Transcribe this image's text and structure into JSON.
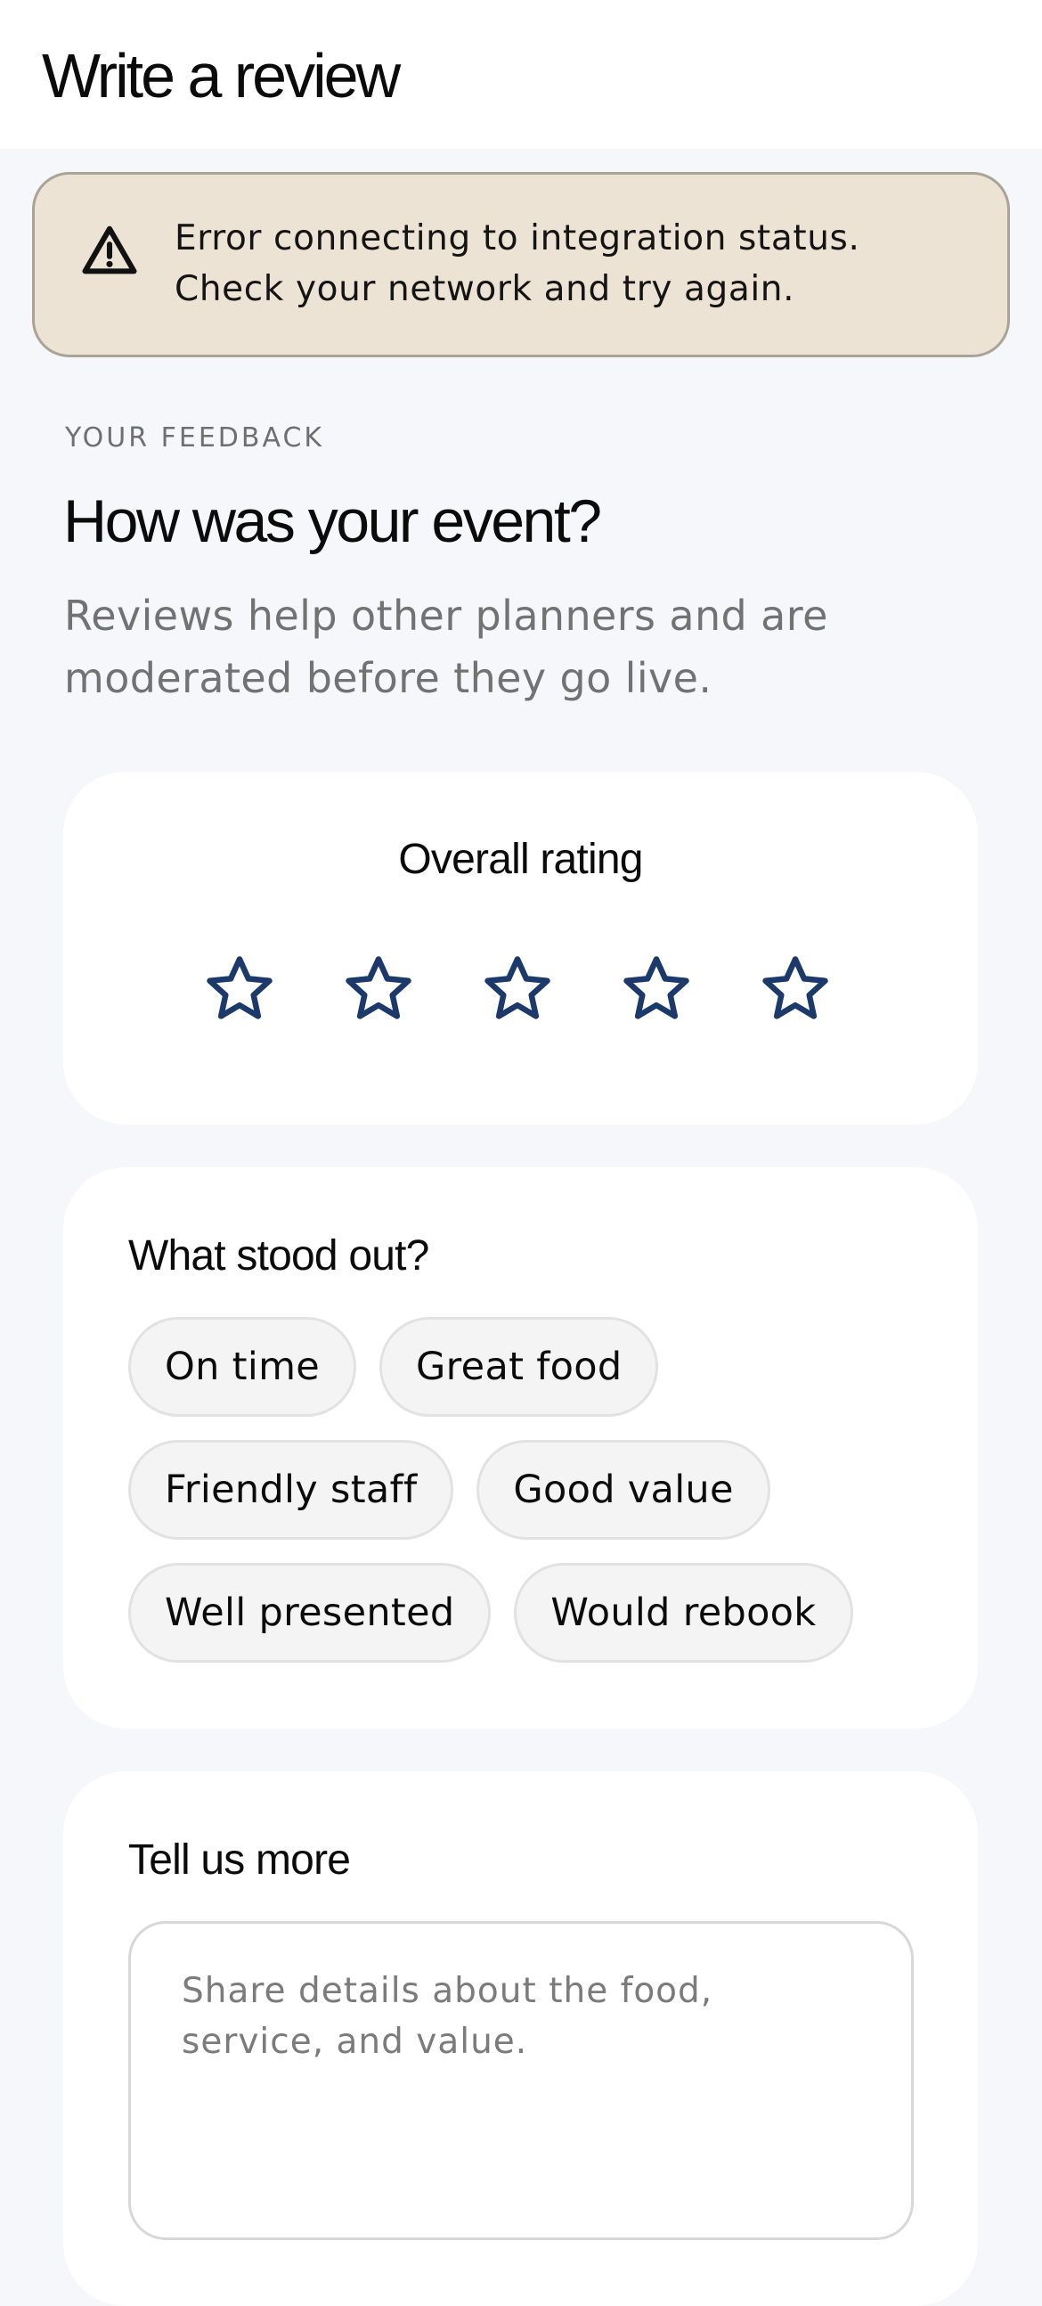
{
  "header": {
    "title": "Write a review"
  },
  "alert": {
    "icon": "warning-triangle-icon",
    "message": "Error connecting to integration status. Check your network and try again.",
    "background": "#ede3d5",
    "border": "#aaa396"
  },
  "intro": {
    "eyebrow": "YOUR FEEDBACK",
    "title": "How was your event?",
    "subtitle": "Reviews help other planners and are moderated before they go live."
  },
  "rating": {
    "label": "Overall rating",
    "value": 0,
    "max": 5,
    "star_icon": "star-outline-icon",
    "star_color": "#1b3a6b"
  },
  "highlights": {
    "label": "What stood out?",
    "rows": [
      [
        "On time",
        "Great food"
      ],
      [
        "Friendly staff",
        "Good value"
      ],
      [
        "Well presented",
        "Would rebook"
      ]
    ]
  },
  "details": {
    "label": "Tell us more",
    "placeholder": "Share details about the food, service, and value.",
    "value": ""
  }
}
